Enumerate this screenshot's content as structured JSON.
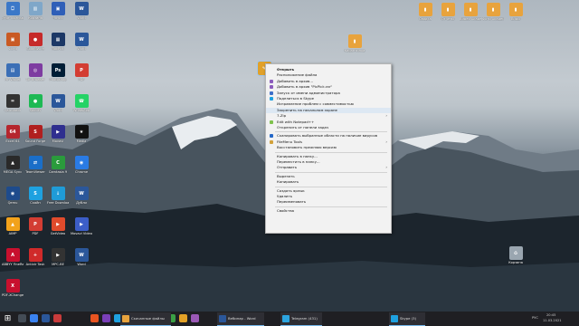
{
  "desktop_icons_left": [
    {
      "label": "Этот компьютер",
      "color": "#3b78c8",
      "glyph": "⎕"
    },
    {
      "label": "Фото",
      "color": "#c95a24",
      "glyph": "▣"
    },
    {
      "label": "HP Wallet",
      "color": "#3b6fb6",
      "glyph": "▤"
    },
    {
      "label": "Calculator",
      "color": "#333333",
      "glyph": "="
    },
    {
      "label": "Excel 64",
      "color": "#b5262e",
      "glyph": "64"
    },
    {
      "label": "MEGA Sync",
      "color": "#2a2a2a",
      "glyph": "▲"
    },
    {
      "label": "Qemu",
      "color": "#1e4b8c",
      "glyph": "◉"
    },
    {
      "label": "AIMP",
      "color": "#f2a21b",
      "glyph": "▲"
    },
    {
      "label": "ABBYY FineReader",
      "color": "#c8102e",
      "glyph": "A"
    },
    {
      "label": "PDF-XChange",
      "color": "#c8102e",
      "glyph": "X"
    }
  ],
  "desktop_icons_col2": [
    {
      "label": "Корзина",
      "color": "#7fa7c9",
      "glyph": "▥"
    },
    {
      "label": "SoundWire",
      "color": "#c62a2a",
      "glyph": "●"
    },
    {
      "label": "Tor Browser",
      "color": "#7e3ca1",
      "glyph": "◎"
    },
    {
      "label": "Spotify",
      "color": "#1db954",
      "glyph": "●"
    },
    {
      "label": "Sound Forge",
      "color": "#b01f1f",
      "glyph": "S"
    },
    {
      "label": "TeamViewer",
      "color": "#1a6ec8",
      "glyph": "⇄"
    },
    {
      "label": "Скайп",
      "color": "#1ea1e0",
      "glyph": "S"
    },
    {
      "label": "PDF",
      "color": "#d33d33",
      "glyph": "P"
    },
    {
      "label": "Antivir Task",
      "color": "#d02a2a",
      "glyph": "+"
    }
  ],
  "desktop_icons_col3": [
    {
      "label": "Чатик",
      "color": "#2f5fb8",
      "glyph": "▣"
    },
    {
      "label": "RocPict",
      "color": "#1c3866",
      "glyph": "▦"
    },
    {
      "label": "Photoshop",
      "color": "#001e36",
      "glyph": "Ps"
    },
    {
      "label": "Word",
      "color": "#2b579a",
      "glyph": "W"
    },
    {
      "label": "Movavi",
      "color": "#2f2f8f",
      "glyph": "▶"
    },
    {
      "label": "Camtasia 9",
      "color": "#2a9b3c",
      "glyph": "C"
    },
    {
      "label": "Free Download",
      "color": "#1f9bd7",
      "glyph": "↓"
    },
    {
      "label": "GetVideo",
      "color": "#e04b2c",
      "glyph": "▶"
    },
    {
      "label": "MPC-BE",
      "color": "#333333",
      "glyph": "▶"
    }
  ],
  "desktop_icons_col4": [
    {
      "label": "Word",
      "color": "#2b579a",
      "glyph": "W"
    },
    {
      "label": "Word",
      "color": "#2b579a",
      "glyph": "W"
    },
    {
      "label": "PDF",
      "color": "#d33d33",
      "glyph": "P"
    },
    {
      "label": "WhatsApp",
      "color": "#25d366",
      "glyph": "☎"
    },
    {
      "label": "Media",
      "color": "#111111",
      "glyph": "★"
    },
    {
      "label": "Chrome",
      "color": "#2a7be4",
      "glyph": "◉"
    },
    {
      "label": "Дубли",
      "color": "#2b579a",
      "glyph": "W"
    },
    {
      "label": "Movavi Video Suite 21",
      "color": "#3c5ec8",
      "glyph": "▶"
    },
    {
      "label": "Word",
      "color": "#2b579a",
      "glyph": "W"
    }
  ],
  "desktop_icons_top_right": [
    {
      "label": "Сводка",
      "color": "#e8a33d"
    },
    {
      "label": "Отчёты",
      "color": "#e8a33d"
    },
    {
      "label": "Видео Академия",
      "color": "#e8a33d"
    },
    {
      "label": "Фото Академия",
      "color": "#e8a33d"
    },
    {
      "label": "Виды",
      "color": "#e8a33d"
    }
  ],
  "folder_mid": {
    "label": "Карантинка",
    "color": "#e8a33d"
  },
  "recycle_right": {
    "label": "Корзина",
    "color": "#9aa6b0"
  },
  "selected_icon": {
    "label": "",
    "color": "#e0a12a"
  },
  "context_menu": {
    "items": [
      {
        "label": "Открыть",
        "bold": true,
        "icon": ""
      },
      {
        "label": "Расположение файла",
        "icon": ""
      },
      {
        "label": "Добавить в архив...",
        "icon": "#8b5cbd"
      },
      {
        "label": "Добавить в архив \"PicPick.rar\"",
        "icon": "#8b5cbd"
      },
      {
        "label": "Запуск от имени администратора",
        "icon": "#3d6fc9"
      },
      {
        "label": "Поделиться в Skype",
        "icon": "#1ea1e0"
      },
      {
        "label": "Исправление проблем с совместимостью",
        "icon": ""
      },
      {
        "label": "Закрепить на начальном экране",
        "icon": "",
        "highlight": true
      },
      {
        "label": "7-Zip",
        "icon": "",
        "submenu": true
      },
      {
        "label": "Edit with Notepad++",
        "icon": "#7fc24c"
      },
      {
        "label": "Открепить от панели задач",
        "icon": ""
      },
      {
        "sep": true
      },
      {
        "label": "Сканировать выбранные области на наличие вирусов",
        "icon": "#2468c8"
      },
      {
        "label": "FileMenu Tools",
        "icon": "#d2a23b",
        "submenu": true
      },
      {
        "label": "Восстановить прежнюю версию",
        "icon": ""
      },
      {
        "sep": true
      },
      {
        "label": "Копировать в папку...",
        "icon": ""
      },
      {
        "label": "Переместить в папку...",
        "icon": ""
      },
      {
        "label": "Отправить",
        "icon": "",
        "submenu": true
      },
      {
        "sep": true
      },
      {
        "label": "Вырезать",
        "icon": ""
      },
      {
        "label": "Копировать",
        "icon": ""
      },
      {
        "sep": true
      },
      {
        "label": "Создать ярлык",
        "icon": ""
      },
      {
        "label": "Удалить",
        "icon": ""
      },
      {
        "label": "Переименовать",
        "icon": ""
      },
      {
        "sep": true
      },
      {
        "label": "Свойства",
        "icon": ""
      }
    ],
    "submenu_arrow": "›"
  },
  "taskbar": {
    "start_icon": "⊞",
    "pinned_colors": [
      "#444c56",
      "#3a82f0",
      "#2b579a",
      "#c93b3b",
      "#e95420",
      "#7a3fb8",
      "#1ea1e0",
      "#2f6bd1",
      "#d13438",
      "#3b9f45",
      "#e3a126",
      "#9b59b6"
    ],
    "windows": [
      {
        "label": "Скачанные файлы",
        "color": "#e8a33d"
      },
      {
        "label": "Вебинар - Word",
        "color": "#2b579a"
      },
      {
        "label": "Telegram (431)",
        "color": "#2ca5e0"
      },
      {
        "label": "Skype (3)",
        "color": "#1ea1e0"
      }
    ],
    "tray_lang": "РУС",
    "time": "20:45",
    "date": "11.03.2021"
  }
}
